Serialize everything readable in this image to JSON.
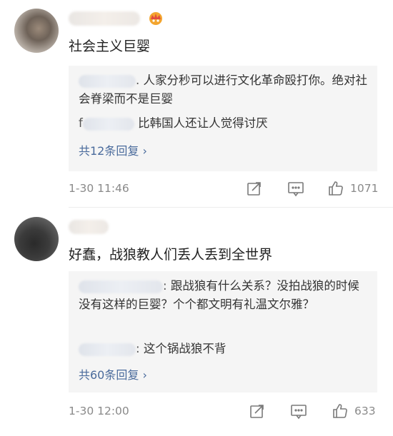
{
  "comments": [
    {
      "text": "社会主义巨婴",
      "replies": [
        {
          "prefix": ".",
          "text": "人家分秒可以进行文化革命殴打你。绝对社会脊梁而不是巨婴"
        },
        {
          "prefix": "f",
          "text": "比韩国人还让人觉得讨厌"
        }
      ],
      "more_label": "共12条回复 ›",
      "timestamp": "1-30 11:46",
      "likes": "1071"
    },
    {
      "text": "好蠢，战狼教人们丢人丢到全世界",
      "replies": [
        {
          "prefix": ":",
          "text": "跟战狼有什么关系？没拍战狼的时候没有这样的巨婴？个个都文明有礼温文尔雅？"
        },
        {
          "prefix": ":",
          "text": "这个锅战狼不背"
        }
      ],
      "more_label": "共60条回复 ›",
      "timestamp": "1-30 12:00",
      "likes": "633"
    }
  ],
  "icons": {
    "share": "share-icon",
    "comment": "comment-icon",
    "like": "thumbs-up-icon",
    "badge": "crown-badge-icon"
  },
  "colors": {
    "link": "#4a6b9c",
    "reply_bg": "#f5f5f5",
    "meta": "#8a8a8a"
  }
}
